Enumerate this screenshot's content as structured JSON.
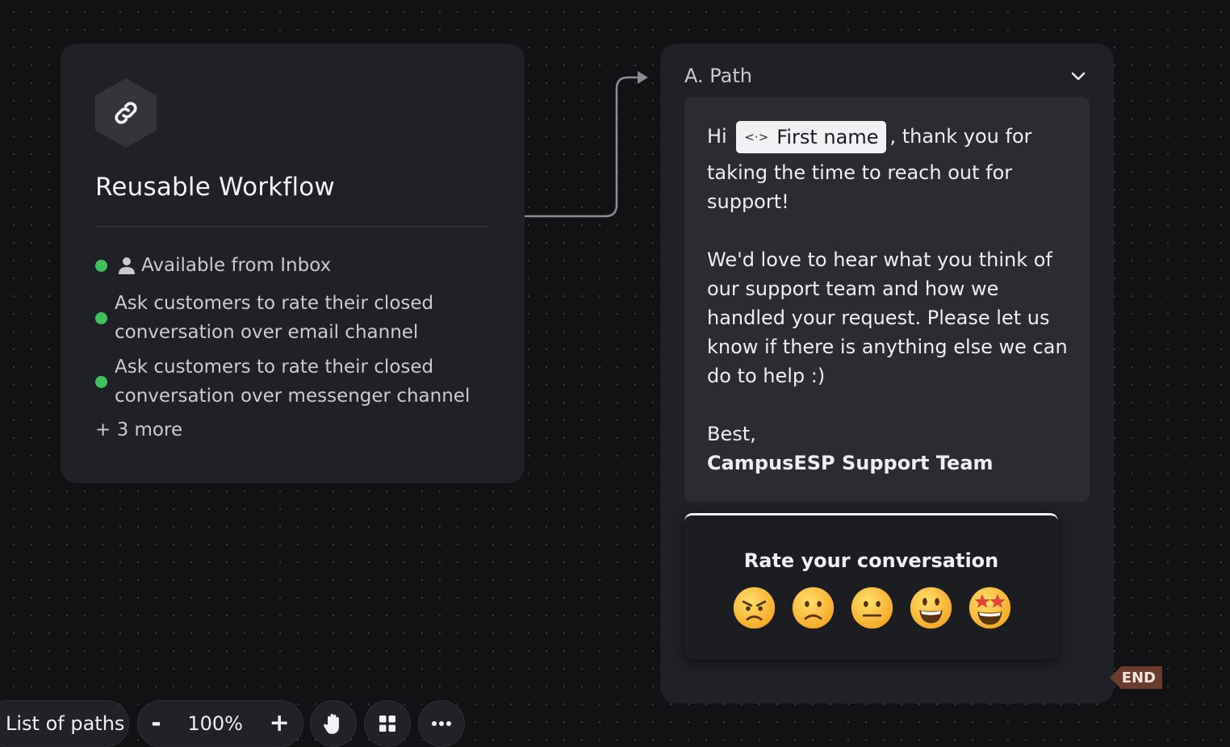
{
  "workflow_card": {
    "icon": "link-icon",
    "title": "Reusable Workflow",
    "availability": "Available from Inbox",
    "descriptions": [
      [
        "Ask customers to rate their closed",
        "conversation over email channel"
      ],
      [
        "Ask customers to rate their closed",
        "conversation over messenger channel"
      ]
    ],
    "more": "+ 3 more",
    "status_color": "#3ec35a"
  },
  "path_card": {
    "title": "A. Path",
    "message": {
      "greeting": "Hi",
      "attribute_chip": "First name",
      "greeting_rest": ", thank you for",
      "lines": [
        "taking the time to reach out for",
        "support!",
        "We'd love to hear what you think of",
        "our support team and how we",
        "handled your request. Please let us",
        "know if there is anything else we can",
        "do to help :)",
        "Best,"
      ],
      "signature": "CampusESP Support Team"
    },
    "rating": {
      "title": "Rate your conversation",
      "emojis": [
        "angry-face",
        "slightly-frowning-face",
        "neutral-face",
        "grinning-face",
        "star-struck-face"
      ]
    },
    "end_label": "END"
  },
  "toolbar": {
    "list_of_paths": "List of paths",
    "zoom_out": "-",
    "zoom_level": "100%",
    "zoom_in": "+",
    "hand_tool": "hand-icon",
    "layout_tool": "grid-icon",
    "more": "more-icon"
  }
}
